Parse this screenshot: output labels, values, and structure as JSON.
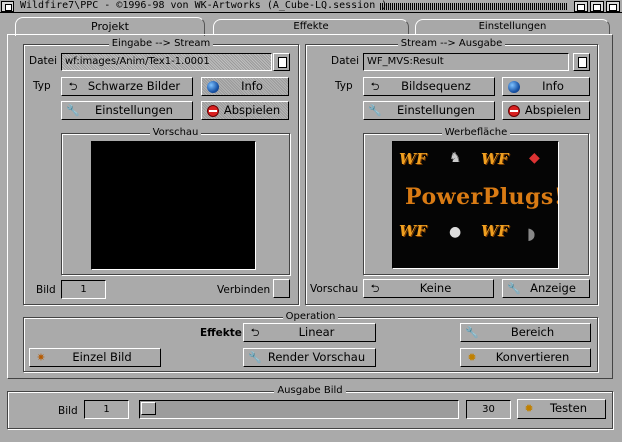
{
  "window": {
    "title": "Wildfire7\\PPC - ©1996-98 von WK-Artworks (A_Cube-LQ.session )"
  },
  "tabs": [
    {
      "label": "Projekt",
      "active": true
    },
    {
      "label": "Effekte",
      "active": false
    },
    {
      "label": "Einstellungen",
      "active": false
    }
  ],
  "input_group": {
    "title": "Eingabe --> Stream",
    "datei_label": "Datei",
    "datei_value": "wf:images/Anim/Tex1-1.0001",
    "typ_label": "Typ",
    "typ_button": "Schwarze Bilder",
    "info_button": "Info",
    "einstellungen_button": "Einstellungen",
    "abspielen_button": "Abspielen",
    "vorschau_title": "Vorschau",
    "bild_label": "Bild",
    "bild_value": "1",
    "verbinden_label": "Verbinden"
  },
  "output_group": {
    "title": "Stream --> Ausgabe",
    "datei_label": "Datei",
    "datei_value": "WF_MVS:Result",
    "typ_label": "Typ",
    "typ_button": "Bildsequenz",
    "info_button": "Info",
    "einstellungen_button": "Einstellungen",
    "abspielen_button": "Abspielen",
    "werbeflaeche_title": "Werbefläche",
    "ad_text": "PowerPlugs!",
    "wf_text": "WF",
    "vorschau_label": "Vorschau",
    "vorschau_button": "Keine",
    "anzeige_button": "Anzeige"
  },
  "operation": {
    "title": "Operation",
    "effekte_label": "Effekte",
    "linear_button": "Linear",
    "bereich_button": "Bereich",
    "einzel_bild_button": "Einzel Bild",
    "render_vorschau_button": "Render Vorschau",
    "konvertieren_button": "Konvertieren"
  },
  "ausgabe_bild": {
    "title": "Ausgabe Bild",
    "bild_label": "Bild",
    "bild_value": "1",
    "slider_position": 0,
    "end_value": "30",
    "testen_button": "Testen"
  },
  "icons": {
    "cycle": "cycle-icon",
    "info": "globe-icon",
    "settings": "wrench-icon",
    "play": "stop-sign-icon",
    "render": "gear-icon"
  },
  "colors": {
    "background": "#aaaaaa",
    "shine": "#ffffff",
    "shadow": "#000000",
    "logo_orange": "#d97b14"
  }
}
